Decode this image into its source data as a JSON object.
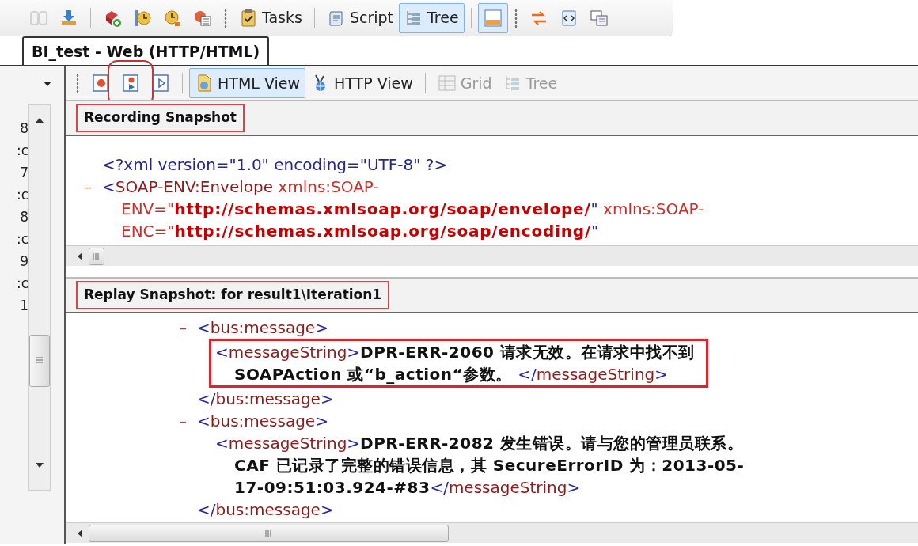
{
  "toolbar": {
    "items": [
      {
        "kind": "icon",
        "disabled": true,
        "selected": false
      },
      {
        "kind": "icon",
        "disabled": false,
        "selected": false
      },
      {
        "kind": "sep"
      },
      {
        "kind": "icon",
        "disabled": false,
        "selected": false
      },
      {
        "kind": "icon",
        "disabled": false,
        "selected": false
      },
      {
        "kind": "icon",
        "disabled": false,
        "selected": false
      },
      {
        "kind": "icon",
        "disabled": false,
        "selected": false
      },
      {
        "kind": "grip"
      },
      {
        "kind": "button",
        "label": "Tasks",
        "disabled": false,
        "selected": false
      },
      {
        "kind": "sep"
      },
      {
        "kind": "button",
        "label": "Script",
        "disabled": false,
        "selected": false
      },
      {
        "kind": "button",
        "label": "Tree",
        "disabled": false,
        "selected": true
      },
      {
        "kind": "sep"
      },
      {
        "kind": "icon",
        "disabled": false,
        "selected": true
      },
      {
        "kind": "grip"
      },
      {
        "kind": "icon",
        "disabled": false,
        "selected": false
      },
      {
        "kind": "icon",
        "disabled": false,
        "selected": false
      },
      {
        "kind": "icon",
        "disabled": false,
        "selected": false
      }
    ]
  },
  "tabs": [
    {
      "label": "BI_test - Web (HTTP/HTML)",
      "selected": true
    }
  ],
  "left_pane": {
    "fragments": [
      "8",
      ":c",
      "7",
      ":c",
      "8",
      ":c",
      "9",
      ":c",
      "1"
    ]
  },
  "view_toolbar": {
    "items": [
      {
        "kind": "grip"
      },
      {
        "kind": "icon",
        "disabled": false,
        "selected": false,
        "highlighted": false
      },
      {
        "kind": "icon",
        "disabled": false,
        "selected": false,
        "highlighted": true
      },
      {
        "kind": "icon",
        "disabled": false,
        "selected": false,
        "highlighted": false
      },
      {
        "kind": "sep"
      },
      {
        "kind": "button",
        "label": "HTML View",
        "disabled": false,
        "selected": true,
        "highlighted": false
      },
      {
        "kind": "button",
        "label": "HTTP View",
        "disabled": false,
        "selected": false,
        "highlighted": false
      },
      {
        "kind": "sep"
      },
      {
        "kind": "button",
        "label": "Grid",
        "disabled": true,
        "selected": false,
        "highlighted": false
      },
      {
        "kind": "button",
        "label": "Tree",
        "disabled": true,
        "selected": false,
        "highlighted": false
      }
    ]
  },
  "recording": {
    "title": "Recording Snapshot",
    "nodes": [
      {
        "lines": [
          [
            {
              "kind": "decl",
              "text": "<?xml version=\"1.0\" encoding=\"UTF-8\" ?>"
            }
          ]
        ]
      },
      {
        "toggle": "–",
        "lines": [
          [
            {
              "kind": "punct",
              "text": "<"
            },
            {
              "kind": "tag",
              "text": "SOAP-ENV:Envelope"
            },
            {
              "kind": "attr",
              "text": " xmlns:SOAP-"
            }
          ],
          [
            {
              "kind": "attr",
              "text": "ENV=\""
            },
            {
              "kind": "value",
              "text": "http://schemas.xmlsoap.org/soap/envelope/"
            },
            {
              "kind": "punct",
              "text": "\""
            },
            {
              "kind": "attr",
              "text": " xmlns:SOAP-"
            }
          ],
          [
            {
              "kind": "attr",
              "text": "ENC=\""
            },
            {
              "kind": "value",
              "text": "http://schemas.xmlsoap.org/soap/encoding/"
            },
            {
              "kind": "punct",
              "text": "\""
            }
          ]
        ]
      }
    ]
  },
  "replay": {
    "title": "Replay Snapshot: for result1\\Iteration1",
    "nodes": [
      {
        "toggle": "–",
        "lines": [
          [
            {
              "kind": "punct",
              "text": "<"
            },
            {
              "kind": "tag",
              "text": "bus:message"
            },
            {
              "kind": "punct",
              "text": ">"
            }
          ]
        ],
        "children": [
          {
            "highlighted": true,
            "lines": [
              [
                {
                  "kind": "punct",
                  "text": "<"
                },
                {
                  "kind": "tag",
                  "text": "messageString"
                },
                {
                  "kind": "punct",
                  "text": ">"
                },
                {
                  "kind": "text",
                  "text": "DPR-ERR-2060 请求无效。在请求中找不到"
                }
              ],
              [
                {
                  "kind": "text",
                  "text": "SOAPAction 或“b_action“参数。 "
                },
                {
                  "kind": "punct",
                  "text": "</"
                },
                {
                  "kind": "tag",
                  "text": "messageString"
                },
                {
                  "kind": "punct",
                  "text": ">"
                }
              ]
            ]
          }
        ],
        "close": [
          {
            "kind": "punct",
            "text": "</"
          },
          {
            "kind": "tag",
            "text": "bus:message"
          },
          {
            "kind": "punct",
            "text": ">"
          }
        ]
      },
      {
        "toggle": "–",
        "lines": [
          [
            {
              "kind": "punct",
              "text": "<"
            },
            {
              "kind": "tag",
              "text": "bus:message"
            },
            {
              "kind": "punct",
              "text": ">"
            }
          ]
        ],
        "children": [
          {
            "highlighted": false,
            "lines": [
              [
                {
                  "kind": "punct",
                  "text": "<"
                },
                {
                  "kind": "tag",
                  "text": "messageString"
                },
                {
                  "kind": "punct",
                  "text": ">"
                },
                {
                  "kind": "text",
                  "text": "DPR-ERR-2082 发生错误。请与您的管理员联系。"
                }
              ],
              [
                {
                  "kind": "text",
                  "text": "CAF 已记录了完整的错误信息，其 SecureErrorID 为：2013-05-"
                }
              ],
              [
                {
                  "kind": "text",
                  "text": "17-09:51:03.924-#83"
                },
                {
                  "kind": "punct",
                  "text": "</"
                },
                {
                  "kind": "tag",
                  "text": "messageString"
                },
                {
                  "kind": "punct",
                  "text": ">"
                }
              ]
            ]
          }
        ],
        "close": [
          {
            "kind": "punct",
            "text": "</"
          },
          {
            "kind": "tag",
            "text": "bus:message"
          },
          {
            "kind": "punct",
            "text": ">"
          }
        ]
      }
    ]
  }
}
